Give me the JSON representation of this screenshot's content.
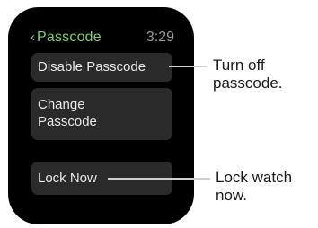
{
  "screen": {
    "title": "Passcode",
    "back_glyph": "‹",
    "time": "3:29"
  },
  "buttons": {
    "disable_passcode": "Disable Passcode",
    "change_passcode_line1": "Change",
    "change_passcode_line2": "Passcode",
    "lock_now": "Lock Now"
  },
  "callouts": {
    "disable_line1": "Turn off",
    "disable_line2": "passcode.",
    "lock_line1": "Lock watch",
    "lock_line2": "now."
  },
  "colors": {
    "accent_green": "#7ed26b",
    "button_bg": "#2a2a2a",
    "screen_bg": "#000000"
  }
}
